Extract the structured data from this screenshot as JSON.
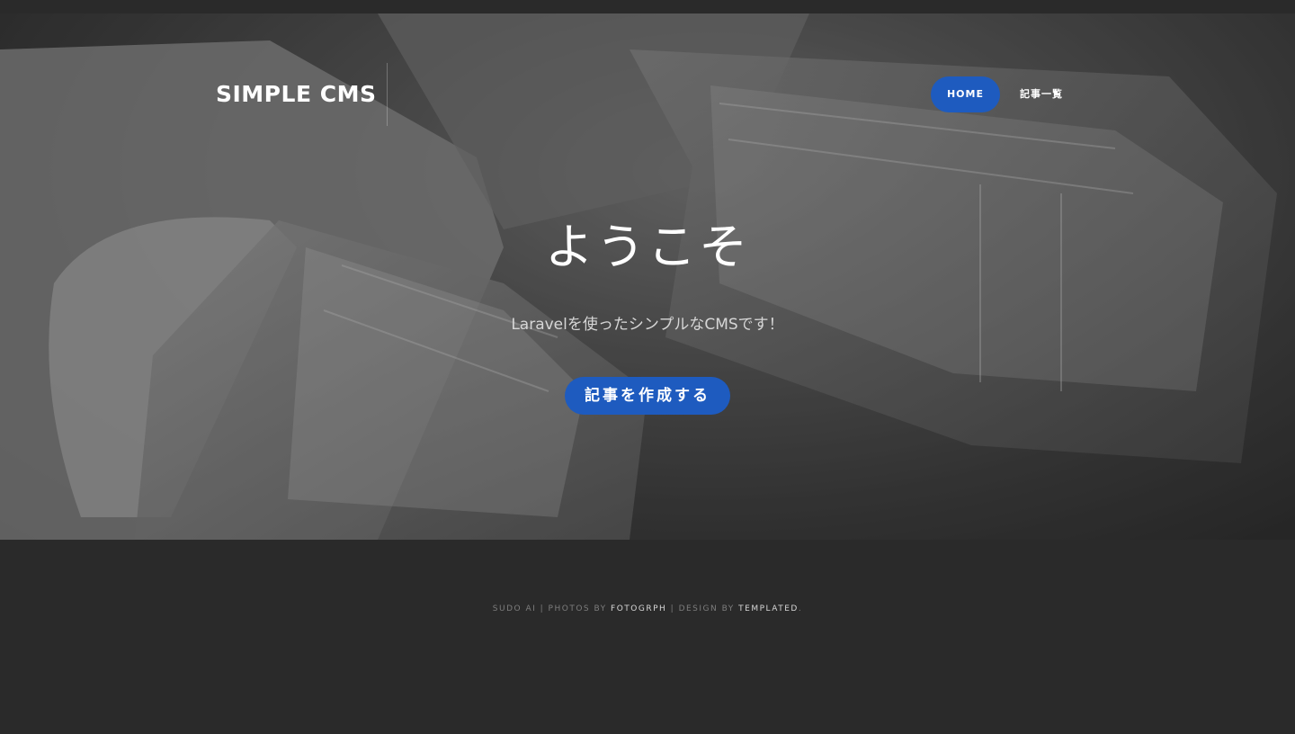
{
  "header": {
    "logo": "SIMPLE CMS",
    "nav": [
      {
        "label": "HOME",
        "active": true
      },
      {
        "label": "記事一覧",
        "active": false
      }
    ]
  },
  "hero": {
    "title": "ようこそ",
    "subtitle": "Laravelを使ったシンプルなCMSです！",
    "cta_label": "記事を作成する",
    "image": "ethernet-cables-photo"
  },
  "footer": {
    "brand": "SUDO AI",
    "sep1": " | ",
    "photos_prefix": "PHOTOS BY ",
    "photos_link": "FOTOGRPH",
    "sep2": " | ",
    "design_prefix": "DESIGN BY ",
    "design_link": "TEMPLATED",
    "end": "."
  },
  "colors": {
    "accent": "#1e5bbf",
    "background": "#2a2a2a"
  }
}
